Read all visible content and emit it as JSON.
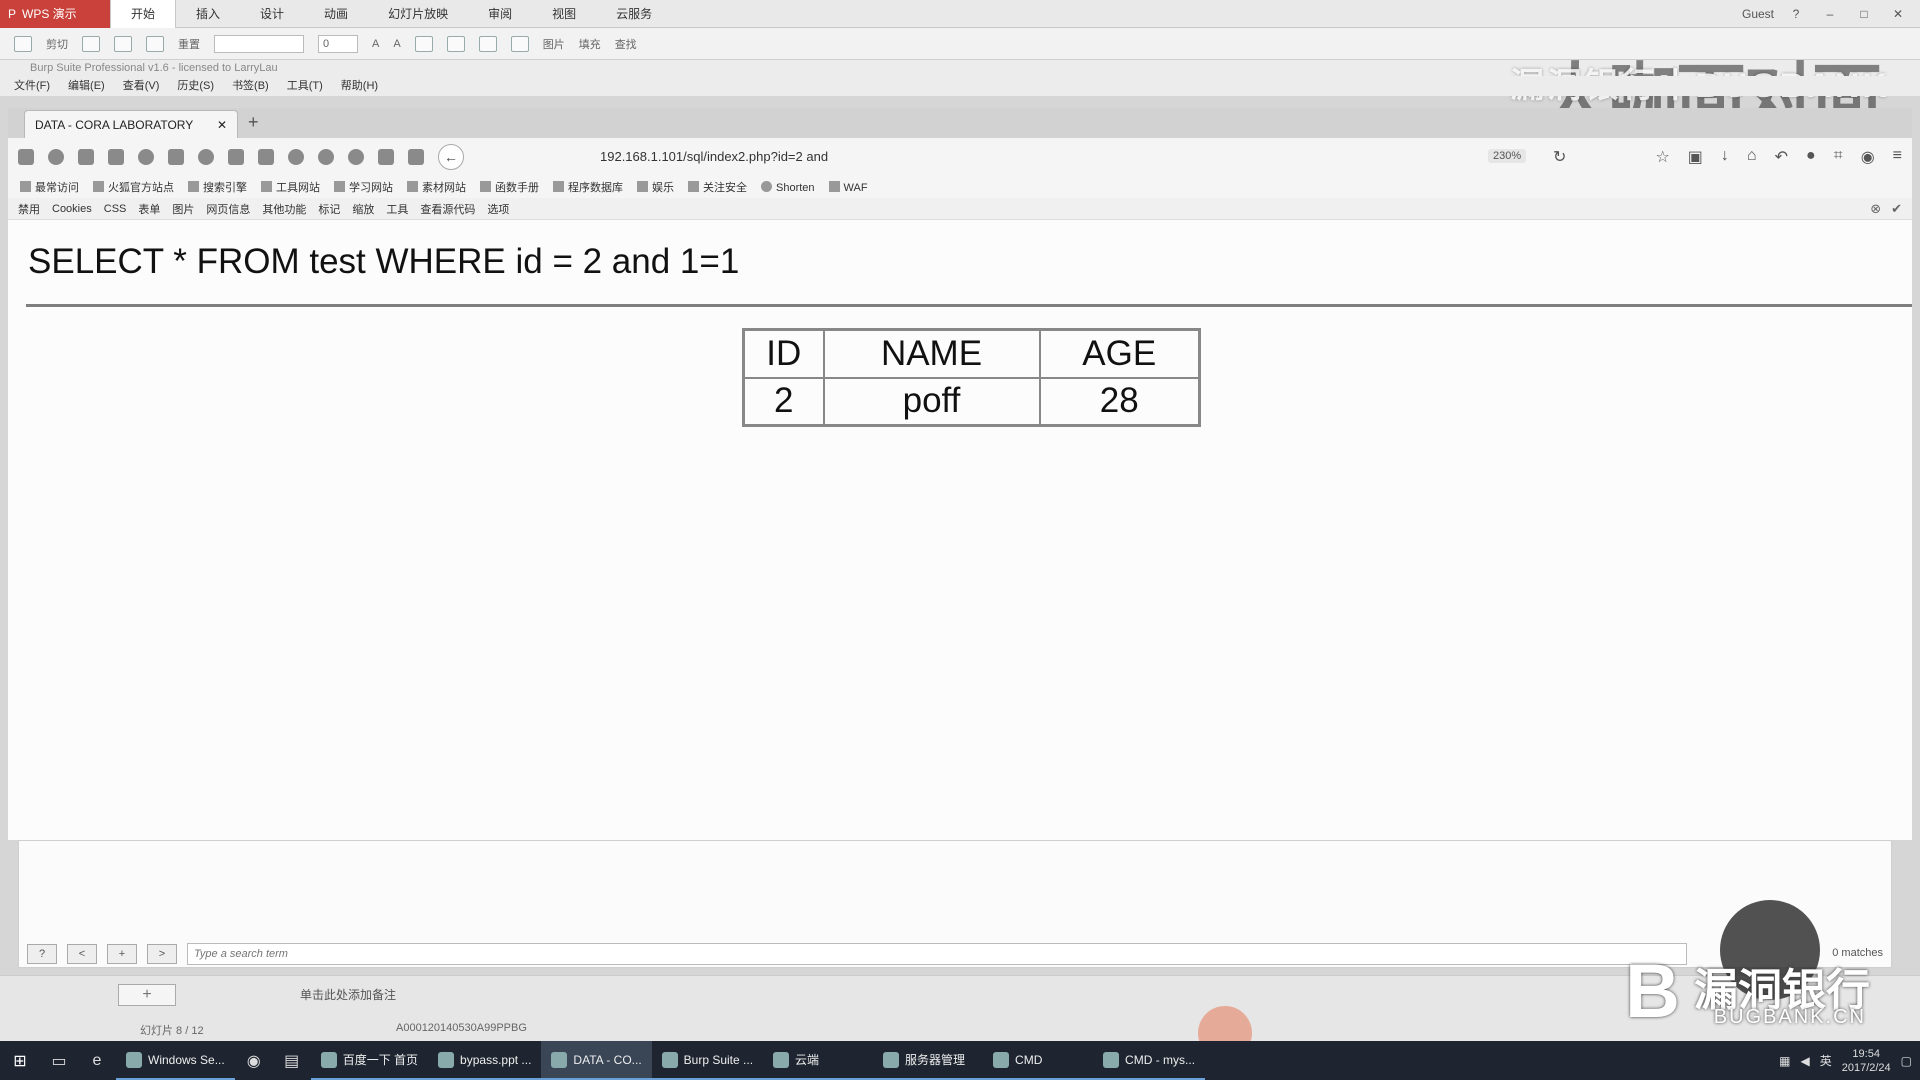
{
  "wps": {
    "logo": "WPS 演示",
    "tabs": [
      "开始",
      "插入",
      "设计",
      "动画",
      "幻灯片放映",
      "审阅",
      "视图",
      "云服务"
    ],
    "user": "Guest",
    "toolbar": {
      "cut": "剪切",
      "reset": "重置",
      "font_size": "0",
      "picture": "图片",
      "fill": "填充",
      "find": "查找"
    },
    "notes_placeholder": "单击此处添加备注",
    "slide_number": "幻灯片 8 / 12",
    "file_code": "A000120140530A99PPBG"
  },
  "burp": {
    "title": "Burp Suite Professional v1.6 - licensed to LarryLau",
    "menu": [
      "文件(F)",
      "编辑(E)",
      "查看(V)",
      "历史(S)",
      "书签(B)",
      "工具(T)",
      "帮助(H)"
    ],
    "search_placeholder": "Type a search term",
    "matches": "0 matches",
    "search_buttons": [
      "?",
      "<",
      "+",
      ">"
    ]
  },
  "watermark": {
    "top_text": "漏洞银行丨BUGBANK",
    "top_logo": "大咖面对面",
    "bottom_cn": "漏洞银行",
    "bottom_en": "BUGBANK.CN"
  },
  "browser": {
    "tab_title": "DATA - CORA LABORATORY",
    "url": "192.168.1.101/sql/index2.php?id=2 and",
    "zoom": "230%",
    "bookmarks": [
      "最常访问",
      "火狐官方站点",
      "搜索引擎",
      "工具网站",
      "学习网站",
      "素材网站",
      "函数手册",
      "程序数据库",
      "娱乐",
      "关注安全",
      "Shorten",
      "WAF"
    ],
    "devbar": [
      "禁用",
      "Cookies",
      "CSS",
      "表单",
      "图片",
      "网页信息",
      "其他功能",
      "标记",
      "缩放",
      "工具",
      "查看源代码",
      "选项"
    ]
  },
  "page": {
    "sql": "SELECT * FROM test WHERE id = 2 and 1=1",
    "table": {
      "headers": [
        "ID",
        "NAME",
        "AGE"
      ],
      "rows": [
        [
          "2",
          "poff",
          "28"
        ]
      ]
    }
  },
  "taskbar": {
    "items": [
      "Windows Se...",
      "百度一下 首页",
      "bypass.ppt ...",
      "DATA - CO...",
      "Burp Suite ...",
      "云端",
      "服务器管理",
      "CMD",
      "CMD - mys..."
    ],
    "time": "19:54",
    "date": "2017/2/24",
    "ime": "英"
  },
  "colors": {
    "wps_accent": "#c9413a",
    "taskbar": "#1e2530",
    "content_bg": "#fcfcfc"
  }
}
